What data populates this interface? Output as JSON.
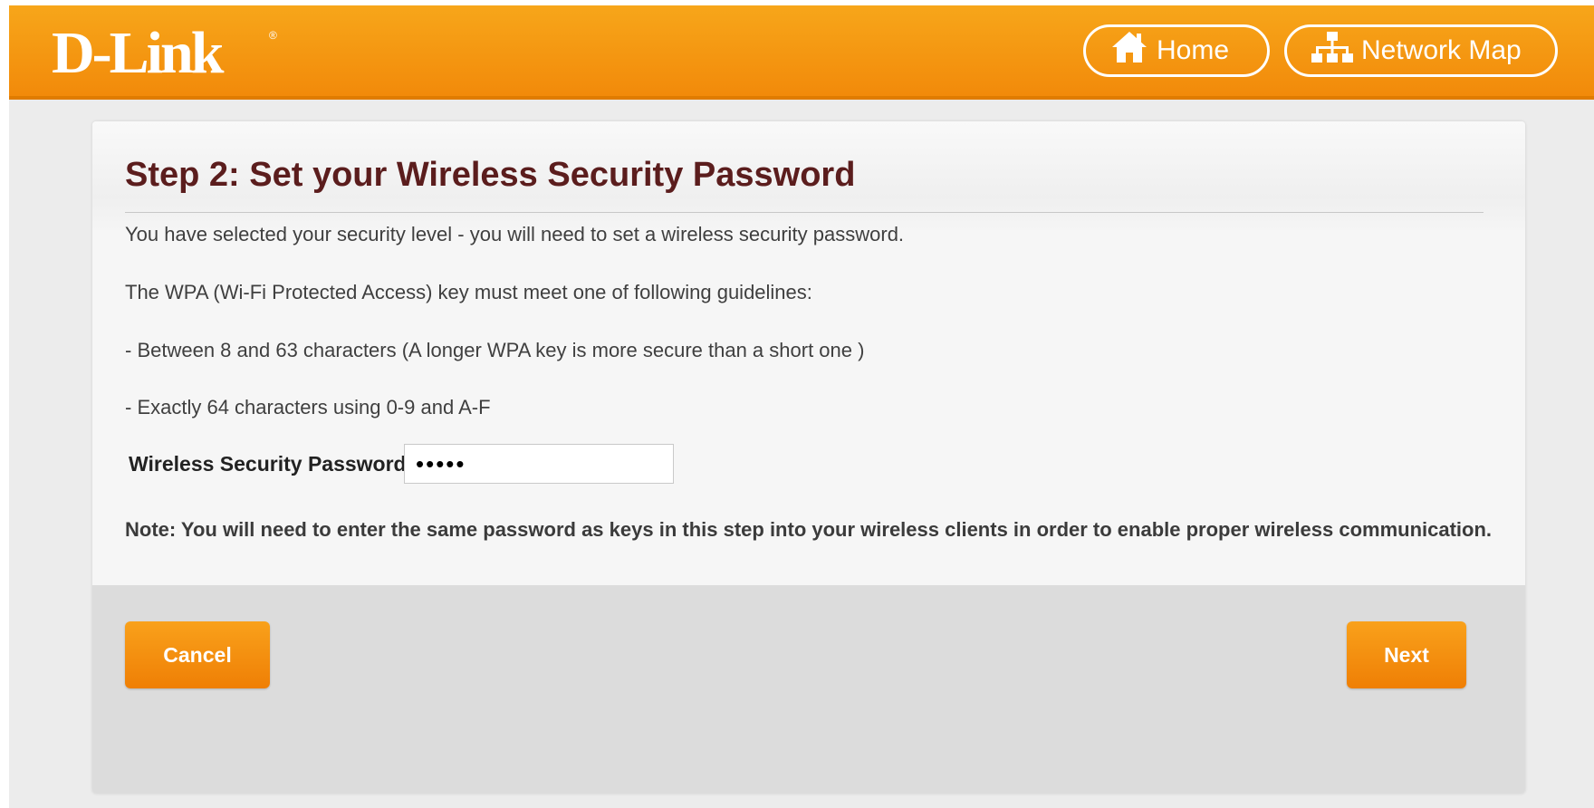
{
  "brand": {
    "logo_text": "D-Link",
    "registered_mark": "®",
    "accent_color": "#f28a0a",
    "title_color": "#5b1d1d"
  },
  "header": {
    "nav": [
      {
        "label": "Home",
        "icon": "home-icon"
      },
      {
        "label": "Network Map",
        "icon": "network-map-icon"
      }
    ]
  },
  "main": {
    "title": "Step 2: Set your Wireless Security Password",
    "paragraphs": [
      "You have selected your security level - you will need to set a wireless security password.",
      "The WPA (Wi-Fi Protected Access) key must meet one of following guidelines:",
      "- Between 8 and 63 characters (A longer WPA key is more secure than a short one )",
      "- Exactly 64 characters using 0-9 and A-F"
    ],
    "password_label": "Wireless Security Password:",
    "password_value": "•••••",
    "note": "Note: You will need to enter the same password as keys in this step into your wireless clients in order to enable proper wireless communication."
  },
  "footer": {
    "cancel_label": "Cancel",
    "next_label": "Next"
  }
}
